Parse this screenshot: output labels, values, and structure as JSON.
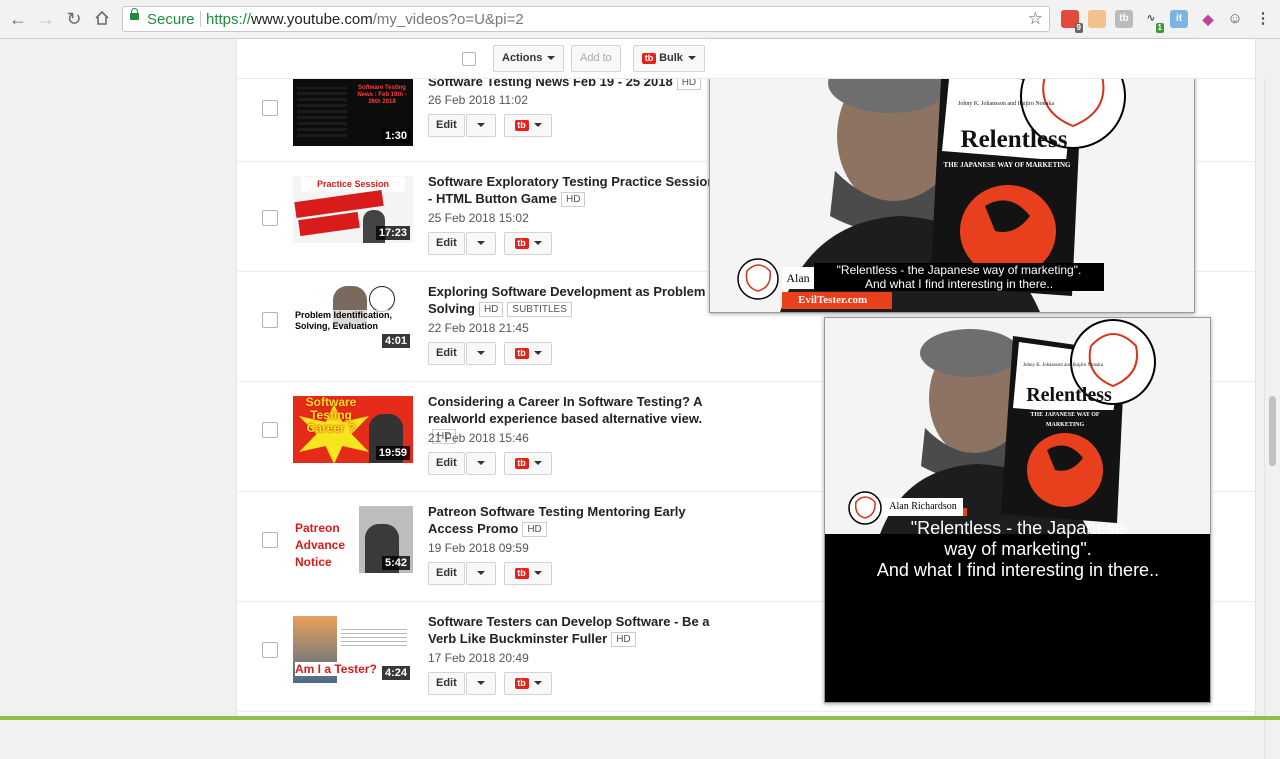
{
  "browser": {
    "secure_label": "Secure",
    "url_scheme": "https://",
    "url_host": "www.youtube.com",
    "url_path": "/my_videos?o=U&pi=2",
    "extension_badges": [
      "9",
      "1"
    ]
  },
  "toolbar": {
    "actions_label": "Actions",
    "add_to_label": "Add to",
    "bulk_label": "Bulk",
    "bulk_icon_text": "tb"
  },
  "videos": [
    {
      "title": "Software Testing News Feb 19 - 25 2018",
      "badges": [
        "HD"
      ],
      "date": "26 Feb 2018 11:02",
      "duration": "1:30",
      "thumb_text": "Software Testing News : Feb 19th - 26th 2018"
    },
    {
      "title": "Software Exploratory Testing Practice Session - HTML Button Game",
      "badges": [
        "HD"
      ],
      "date": "25 Feb 2018 15:02",
      "duration": "17:23",
      "thumb_text": "Practice Session"
    },
    {
      "title": "Exploring Software Development as Problem Solving",
      "badges": [
        "HD",
        "SUBTITLES"
      ],
      "date": "22 Feb 2018 21:45",
      "duration": "4:01",
      "thumb_text": "Problem Identification, Solving, Evaluation"
    },
    {
      "title": "Considering a Career In Software Testing? A realworld experience based alternative view.",
      "badges": [
        "HD"
      ],
      "date": "21 Feb 2018 15:46",
      "duration": "19:59",
      "thumb_text": "Software Testing Career ?"
    },
    {
      "title": "Patreon Software Testing Mentoring Early Access Promo",
      "badges": [
        "HD"
      ],
      "date": "19 Feb 2018 09:59",
      "duration": "5:42",
      "thumb_text": "Patreon Advance Notice"
    },
    {
      "title": "Software Testers can Develop Software - Be a Verb Like Buckminster Fuller",
      "badges": [
        "HD"
      ],
      "date": "17 Feb 2018 20:49",
      "duration": "4:24",
      "thumb_text": "Am I a Tester?"
    }
  ],
  "row_actions": {
    "edit_label": "Edit",
    "tb_icon_text": "tb"
  },
  "popup_small": {
    "name": "Alan",
    "caption": "\"Relentless - the Japanese way of marketing\".\nAnd what I find interesting in there..",
    "site_tag": "EvilTester.com",
    "book_title": "Relentless",
    "book_subtitle": "THE JAPANESE WAY OF MARKETING",
    "book_authors": "Johny K. Johansson and Ikujiro Nonaka"
  },
  "popup_large": {
    "name": "Alan Richardson",
    "caption": "\"Relentless - the Japanese\nway of marketing\".\nAnd what I find interesting in there..",
    "book_title": "Relentless",
    "book_subtitle": "THE JAPANESE WAY OF MARKETING",
    "book_authors": "Johny K. Johansson and Ikujiro Nonaka"
  },
  "colors": {
    "accent_red": "#e62117",
    "secure_green": "#1e8e3e",
    "tag_orange": "#e8401d"
  }
}
